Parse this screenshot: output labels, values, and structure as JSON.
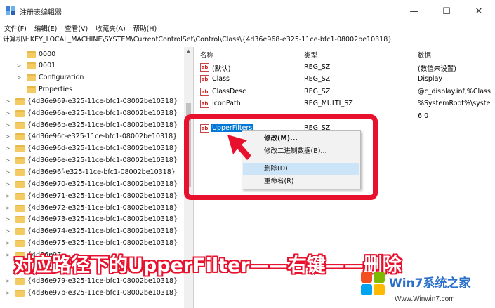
{
  "window": {
    "title": "注册表编辑器",
    "controls": {
      "minimize": "—",
      "maximize": "☐",
      "close": "✕"
    }
  },
  "menu": [
    "文件(F)",
    "编辑(E)",
    "查看(V)",
    "收藏夹(A)",
    "帮助(H)"
  ],
  "address": "计算机\\HKEY_LOCAL_MACHINE\\SYSTEM\\CurrentControlSet\\Control\\Class\\{4d36e968-e325-11ce-bfc1-08002be10318}",
  "tree": {
    "children": [
      "0000",
      "0001",
      "Configuration",
      "Properties"
    ],
    "keys": [
      "{4d36e969-e325-11ce-bfc1-08002be10318}",
      "{4d36e96a-e325-11ce-bfc1-08002be10318}",
      "{4d36e96b-e325-11ce-bfc1-08002be10318}",
      "{4d36e96c-e325-11ce-bfc1-08002be10318}",
      "{4d36e96d-e325-11ce-bfc1-08002be10318}",
      "{4d36e96e-e325-11ce-bfc1-08002be10318}",
      "{4d36e96f-e325-11ce-bfc1-08002be10318}",
      "{4d36e970-e325-11ce-bfc1-08002be10318}",
      "{4d36e971-e325-11ce-bfc1-08002be10318}",
      "{4d36e972-e325-11ce-bfc1-08002be10318}",
      "{4d36e973-e325-11ce-bfc1-08002be10318}",
      "{4d36e974-e325-11ce-bfc1-08002be10318}",
      "{4d36e975-e325-11ce-bfc1-08002be10318}",
      "{4d36e97",
      "{4d36e979-e325-11ce-bfc1-08002be10318}",
      "{4d36e97b-e325-11ce-bfc1-08002be10318}"
    ]
  },
  "values": {
    "headers": {
      "name": "名称",
      "type": "类型",
      "data": "数据"
    },
    "rows": [
      {
        "name": "(默认)",
        "type": "REG_SZ",
        "data": "(数值未设置)"
      },
      {
        "name": "Class",
        "type": "REG_SZ",
        "data": "Display"
      },
      {
        "name": "ClassDesc",
        "type": "REG_SZ",
        "data": "@c_display.inf,%Class"
      },
      {
        "name": "IconPath",
        "type": "REG_MULTI_SZ",
        "data": "%SystemRoot%\\syste"
      },
      {
        "name": "",
        "type": "",
        "data": "6.0"
      },
      {
        "name": "UpperFilters",
        "type": "REG_SZ",
        "data": ""
      }
    ]
  },
  "context_menu": {
    "items": [
      "修改(M)...",
      "修改二进制数据(B)...",
      "删除(D)",
      "重命名(R)"
    ],
    "highlighted": "删除(D)"
  },
  "caption": "对应路径下的UpperFilter——右键——删除",
  "watermark": {
    "brand": "Win7系统之家",
    "url": "Www.Winwin7.com"
  },
  "colors": {
    "annotation_red": "#e8112d",
    "selection_blue": "#0078d7",
    "menu_highlight": "#cce4f7"
  }
}
